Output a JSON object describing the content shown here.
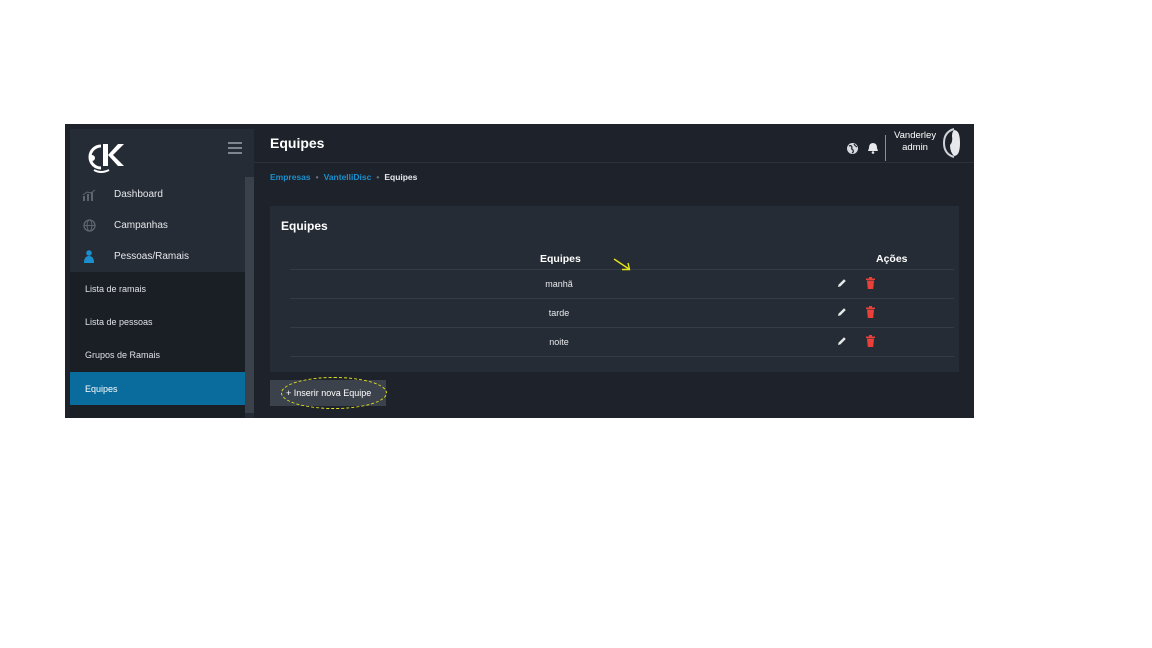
{
  "header": {
    "title": "Equipes"
  },
  "user": {
    "name": "Vanderley",
    "role": "admin"
  },
  "sidebar": {
    "items": [
      {
        "label": "Dashboard"
      },
      {
        "label": "Campanhas"
      },
      {
        "label": "Pessoas/Ramais"
      }
    ],
    "subitems": [
      {
        "label": "Lista de ramais"
      },
      {
        "label": "Lista de pessoas"
      },
      {
        "label": "Grupos de Ramais"
      },
      {
        "label": "Equipes",
        "active": true
      }
    ]
  },
  "breadcrumb": {
    "items": [
      "Empresas",
      "VantelliDisc"
    ],
    "current": "Equipes"
  },
  "card": {
    "title": "Equipes",
    "columns": [
      "Equipes",
      "Ações"
    ],
    "rows": [
      {
        "name": "manhã"
      },
      {
        "name": "tarde"
      },
      {
        "name": "noite"
      }
    ]
  },
  "actions": {
    "insert_label": "+ Inserir nova Equipe"
  },
  "colors": {
    "accent": "#0a6c9c",
    "link": "#1b8fce",
    "delete": "#e8413a",
    "highlight": "#e4e41a"
  }
}
